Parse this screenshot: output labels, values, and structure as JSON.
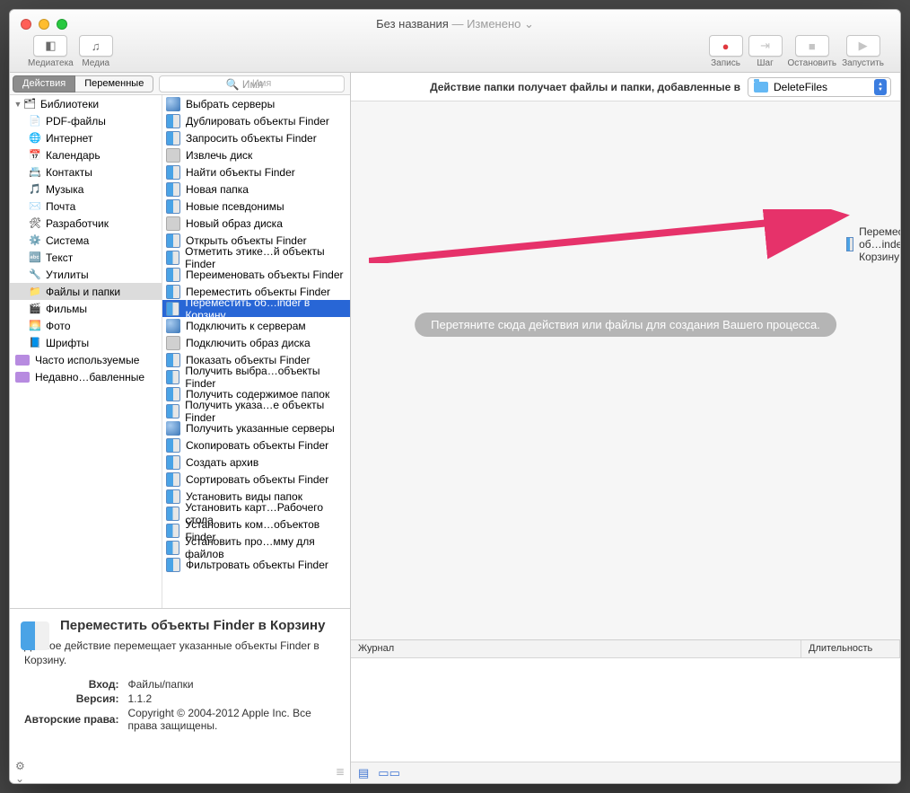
{
  "titlebar": {
    "title": "Без названия",
    "separator": " — ",
    "status": "Изменено",
    "dropdown_glyph": "⌄"
  },
  "toolbar": {
    "left": [
      {
        "name": "library-button",
        "label": "Медиатека",
        "glyph": "◧"
      },
      {
        "name": "media-button",
        "label": "Медиа",
        "glyph": "♫"
      }
    ],
    "right": [
      {
        "name": "record-button",
        "label": "Запись",
        "glyph": "●",
        "color": "#e0383e",
        "disabled": false
      },
      {
        "name": "step-button",
        "label": "Шаг",
        "glyph": "⇥",
        "disabled": true
      },
      {
        "name": "stop-button",
        "label": "Остановить",
        "glyph": "■",
        "disabled": true
      },
      {
        "name": "run-button",
        "label": "Запустить",
        "glyph": "▶",
        "disabled": true
      }
    ]
  },
  "segmented": {
    "actions": "Действия",
    "variables": "Переменные"
  },
  "search": {
    "placeholder": "Имя"
  },
  "library": {
    "root": "Библиотеки",
    "items": [
      {
        "label": "PDF-файлы",
        "icon": "📄"
      },
      {
        "label": "Интернет",
        "icon": "🌐"
      },
      {
        "label": "Календарь",
        "icon": "📅"
      },
      {
        "label": "Контакты",
        "icon": "📇"
      },
      {
        "label": "Музыка",
        "icon": "🎵"
      },
      {
        "label": "Почта",
        "icon": "✉️"
      },
      {
        "label": "Разработчик",
        "icon": "🛠"
      },
      {
        "label": "Система",
        "icon": "⚙️"
      },
      {
        "label": "Текст",
        "icon": "🔤"
      },
      {
        "label": "Утилиты",
        "icon": "🔧"
      },
      {
        "label": "Файлы и папки",
        "icon": "📁",
        "selected": true
      },
      {
        "label": "Фильмы",
        "icon": "🎬"
      },
      {
        "label": "Фото",
        "icon": "🌅"
      },
      {
        "label": "Шрифты",
        "icon": "📘"
      }
    ],
    "smart": [
      {
        "label": "Часто используемые"
      },
      {
        "label": "Недавно…бавленные"
      }
    ]
  },
  "actions": [
    {
      "label": "Выбрать серверы",
      "icon": "globe"
    },
    {
      "label": "Дублировать объекты Finder",
      "icon": "finder"
    },
    {
      "label": "Запросить объекты Finder",
      "icon": "finder"
    },
    {
      "label": "Извлечь диск",
      "icon": "disk"
    },
    {
      "label": "Найти объекты Finder",
      "icon": "finder"
    },
    {
      "label": "Новая папка",
      "icon": "finder"
    },
    {
      "label": "Новые псевдонимы",
      "icon": "finder"
    },
    {
      "label": "Новый образ диска",
      "icon": "disk"
    },
    {
      "label": "Открыть объекты Finder",
      "icon": "finder"
    },
    {
      "label": "Отметить этике…й объекты Finder",
      "icon": "finder"
    },
    {
      "label": "Переименовать объекты Finder",
      "icon": "finder"
    },
    {
      "label": "Переместить объекты Finder",
      "icon": "finder"
    },
    {
      "label": "Переместить об…inder в Корзину",
      "icon": "finder",
      "selected": true
    },
    {
      "label": "Подключить к серверам",
      "icon": "globe"
    },
    {
      "label": "Подключить образ диска",
      "icon": "disk"
    },
    {
      "label": "Показать объекты Finder",
      "icon": "finder"
    },
    {
      "label": "Получить выбра…объекты Finder",
      "icon": "finder"
    },
    {
      "label": "Получить содержимое папок",
      "icon": "finder"
    },
    {
      "label": "Получить указа…е объекты Finder",
      "icon": "finder"
    },
    {
      "label": "Получить указанные серверы",
      "icon": "globe"
    },
    {
      "label": "Скопировать объекты Finder",
      "icon": "finder"
    },
    {
      "label": "Создать архив",
      "icon": "finder"
    },
    {
      "label": "Сортировать объекты Finder",
      "icon": "finder"
    },
    {
      "label": "Установить виды папок",
      "icon": "finder"
    },
    {
      "label": "Установить карт…Рабочего стола",
      "icon": "finder"
    },
    {
      "label": "Установить ком…объектов Finder",
      "icon": "finder"
    },
    {
      "label": "Установить про…мму для файлов",
      "icon": "finder"
    },
    {
      "label": "Фильтровать объекты Finder",
      "icon": "finder"
    }
  ],
  "info": {
    "title": "Переместить объекты Finder в Корзину",
    "desc": "Данное действие перемещает указанные объекты Finder в Корзину.",
    "rows": {
      "input_label": "Вход:",
      "input_val": "Файлы/папки",
      "version_label": "Версия:",
      "version_val": "1.1.2",
      "copyright_label": "Авторские права:",
      "copyright_val": "Copyright © 2004-2012 Apple Inc. Все права защищены."
    }
  },
  "workflow": {
    "header_text": "Действие папки получает файлы и папки, добавленные в",
    "folder": "DeleteFiles",
    "dragged_label": "Переместить об…inder в Корзину",
    "hint": "Перетяните сюда действия или файлы для создания Вашего процесса."
  },
  "log": {
    "col1": "Журнал",
    "col2": "Длительность"
  }
}
